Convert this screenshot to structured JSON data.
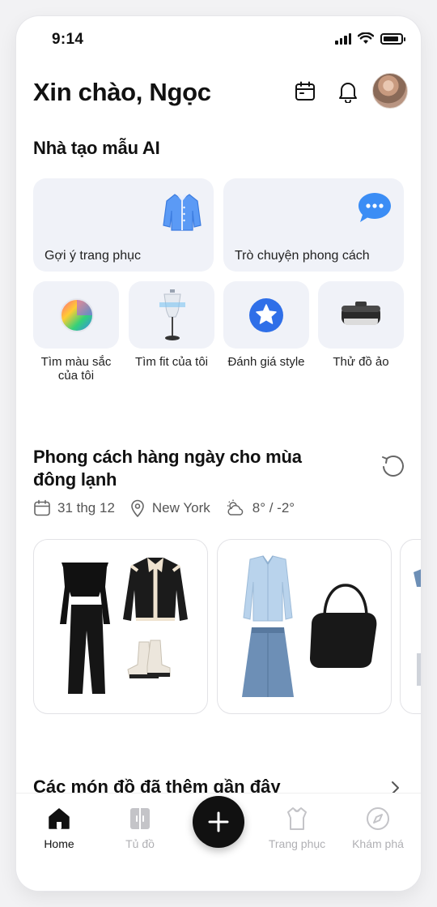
{
  "status_bar": {
    "time": "9:14"
  },
  "header": {
    "greeting": "Xin chào, Ngọc"
  },
  "ai_section": {
    "title": "Nhà tạo mẫu AI",
    "large_cards": [
      {
        "label": "Gợi ý trang phục",
        "icon": "cardigan-icon"
      },
      {
        "label": "Trò chuyện phong cách",
        "icon": "chat-bubble-icon"
      }
    ],
    "small_cards": [
      {
        "label_line1": "Tìm màu sắc",
        "label_line2": "của tôi",
        "icon": "color-wheel-icon"
      },
      {
        "label_line1": "Tìm fit của tôi",
        "label_line2": "",
        "icon": "mannequin-icon"
      },
      {
        "label_line1": "Đánh giá style",
        "label_line2": "",
        "icon": "star-badge-icon"
      },
      {
        "label_line1": "Thử đồ ảo",
        "label_line2": "",
        "icon": "vr-headset-icon"
      }
    ]
  },
  "daily_section": {
    "title_line1": "Phong cách hàng ngày cho mùa",
    "title_line2": "đông lạnh",
    "date": "31 thg 12",
    "location": "New York",
    "weather": "8° / -2°"
  },
  "recent_section": {
    "title": "Các món đồ đã thêm gần đây"
  },
  "nav": {
    "home": "Home",
    "wardrobe": "Tủ đồ",
    "outfits": "Trang phục",
    "explore": "Khám phá"
  },
  "colors": {
    "card_bg": "#f0f2f8",
    "accent_blue": "#3b7df5",
    "text": "#111111",
    "muted": "#b0b0b4"
  }
}
